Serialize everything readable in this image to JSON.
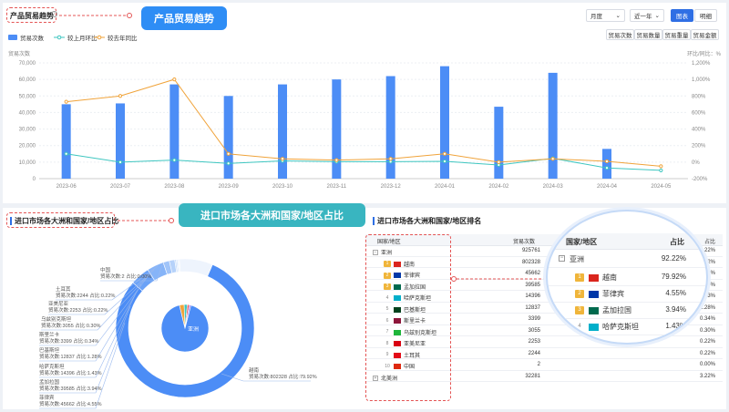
{
  "top": {
    "title": "产品贸易趋势",
    "callout": "产品贸易趋势",
    "period_select": "月度",
    "range_select": "近一年",
    "view_chart": "图表",
    "view_detail": "明细",
    "metric_buttons": [
      "贸易次数",
      "贸易数量",
      "贸易重量",
      "贸易金额"
    ],
    "legend": [
      "贸易次数",
      "较上月环比",
      "较去年同比"
    ],
    "y_left_title": "贸易次数",
    "y_right_title": "环比/同比：%"
  },
  "chart_data": {
    "type": "bar",
    "categories": [
      "2023-06",
      "2023-07",
      "2023-08",
      "2023-09",
      "2023-10",
      "2023-11",
      "2023-12",
      "2024-01",
      "2024-02",
      "2024-03",
      "2024-04",
      "2024-05"
    ],
    "series": [
      {
        "name": "贸易次数",
        "type": "bar",
        "axis": "left",
        "values": [
          45000,
          45500,
          57000,
          50000,
          57000,
          60000,
          62000,
          68000,
          43500,
          64000,
          18000,
          0
        ]
      },
      {
        "name": "较上月环比",
        "type": "line",
        "axis": "right",
        "values": [
          100,
          0,
          25,
          -15,
          15,
          5,
          5,
          10,
          -35,
          45,
          -70,
          -100
        ]
      },
      {
        "name": "较去年同比",
        "type": "line",
        "axis": "right",
        "values": [
          730,
          800,
          1000,
          100,
          40,
          25,
          40,
          100,
          0,
          40,
          10,
          -50
        ]
      }
    ],
    "y_left_ticks": [
      "0",
      "10,000",
      "20,000",
      "30,000",
      "40,000",
      "50,000",
      "60,000",
      "70,000"
    ],
    "y_right_ticks": [
      "-200%",
      "0%",
      "200%",
      "400%",
      "600%",
      "800%",
      "1,000%",
      "1,200%"
    ],
    "ylim_left": [
      0,
      70000
    ],
    "ylim_right": [
      -200,
      1200
    ],
    "colors": {
      "bar": "#4c8df6",
      "mom": "#3ec6c0",
      "yoy": "#f0a33a"
    }
  },
  "bottom": {
    "title": "进口市场各大洲和国家/地区占比",
    "callout": "进口市场各大洲和国家/地区占比",
    "rank_title": "进口市场各大洲和国家/地区排名",
    "columns": [
      "国家/地区",
      "贸易次数",
      "占比"
    ],
    "rows": [
      {
        "rank": "",
        "name": "亚洲",
        "count": "925761",
        "pct": "92.22%",
        "kind": "continent",
        "color": ""
      },
      {
        "rank": "1",
        "name": "越南",
        "count": "802328",
        "pct": "79.92%",
        "kind": "country",
        "color": "#da251d"
      },
      {
        "rank": "2",
        "name": "菲律宾",
        "count": "45662",
        "pct": "4.55%",
        "kind": "country",
        "color": "#0038a8"
      },
      {
        "rank": "3",
        "name": "孟加拉国",
        "count": "39585",
        "pct": "3.94%",
        "kind": "country",
        "color": "#006a4e"
      },
      {
        "rank": "4",
        "name": "哈萨克斯坦",
        "count": "14396",
        "pct": "1.43%",
        "kind": "country",
        "color": "#00afca"
      },
      {
        "rank": "5",
        "name": "巴基斯坦",
        "count": "12837",
        "pct": "1.28%",
        "kind": "country",
        "color": "#01411c"
      },
      {
        "rank": "6",
        "name": "斯里兰卡",
        "count": "3399",
        "pct": "0.34%",
        "kind": "country",
        "color": "#8d153a"
      },
      {
        "rank": "7",
        "name": "乌兹别克斯坦",
        "count": "3055",
        "pct": "0.30%",
        "kind": "country",
        "color": "#1eb53a"
      },
      {
        "rank": "8",
        "name": "亚美尼亚",
        "count": "2253",
        "pct": "0.22%",
        "kind": "country",
        "color": "#d90012"
      },
      {
        "rank": "9",
        "name": "土耳其",
        "count": "2244",
        "pct": "0.22%",
        "kind": "country",
        "color": "#e30a17"
      },
      {
        "rank": "10",
        "name": "中国",
        "count": "2",
        "pct": "0.00%",
        "kind": "country",
        "color": "#de2910"
      },
      {
        "rank": "",
        "name": "北美洲",
        "count": "32281",
        "pct": "3.22%",
        "kind": "continent",
        "color": ""
      }
    ],
    "zoom": {
      "header_name": "国家/地区",
      "header_pct": "占比",
      "continent": "亚洲",
      "continent_pct": "92.22%",
      "rows": [
        {
          "rank": "1",
          "name": "越南",
          "pct": "79.92%",
          "color": "#da251d"
        },
        {
          "rank": "2",
          "name": "菲律宾",
          "pct": "4.55%",
          "color": "#0038a8"
        },
        {
          "rank": "3",
          "name": "孟加拉国",
          "pct": "3.94%",
          "color": "#006a4e"
        },
        {
          "rank": "4",
          "name": "哈萨克斯坦",
          "pct": "1.43%",
          "color": "#00afca"
        }
      ]
    },
    "pie": {
      "inner_label": "亚洲",
      "labels": [
        {
          "name": "中国",
          "detail": "贸易次数:2 占比:0.00%"
        },
        {
          "name": "土耳其",
          "detail": "贸易次数:2244 占比:0.22%"
        },
        {
          "name": "亚美尼亚",
          "detail": "贸易次数:2253 占比:0.22%"
        },
        {
          "name": "乌兹别克斯坦",
          "detail": "贸易次数:3055 占比:0.30%"
        },
        {
          "name": "斯里兰卡",
          "detail": "贸易次数:3399 占比:0.34%"
        },
        {
          "name": "巴基斯坦",
          "detail": "贸易次数:12837 占比:1.28%"
        },
        {
          "name": "哈萨克斯坦",
          "detail": "贸易次数:14396 占比:1.43%"
        },
        {
          "name": "孟加拉国",
          "detail": "贸易次数:39585 占比:3.94%"
        },
        {
          "name": "菲律宾",
          "detail": "贸易次数:45662 占比:4.55%"
        },
        {
          "name": "越南",
          "detail": "贸易次数:802328 占比:79.92%"
        }
      ]
    }
  }
}
